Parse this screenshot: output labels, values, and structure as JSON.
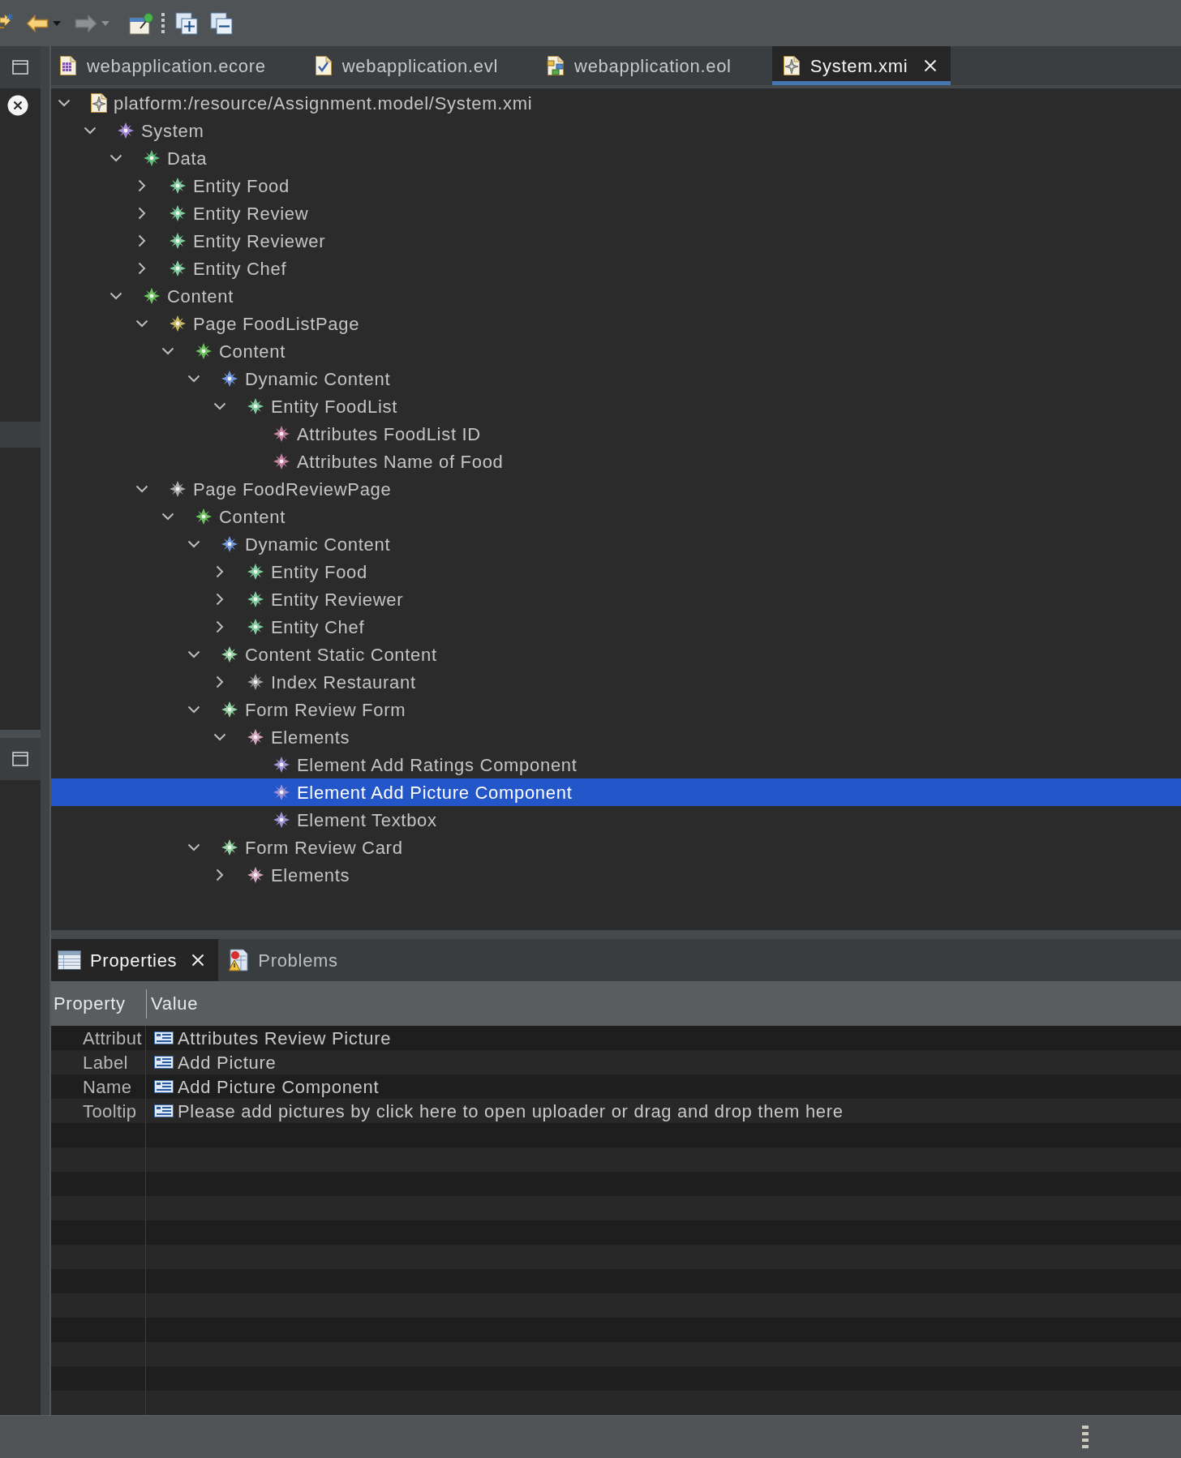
{
  "toolbar": [
    {
      "kind": "sync",
      "disabled": false
    },
    {
      "kind": "back",
      "disabled": false
    },
    {
      "kind": "menu",
      "disabled": false
    },
    {
      "kind": "forward",
      "disabled": true
    },
    {
      "kind": "menu",
      "disabled": true
    },
    {
      "kind": "pin",
      "disabled": false
    },
    {
      "kind": "expand",
      "disabled": false
    },
    {
      "kind": "collapse",
      "disabled": false
    }
  ],
  "editor_tabs": [
    {
      "label": "webapplication.ecore",
      "kind": "ecore",
      "selected": false
    },
    {
      "label": "webapplication.evl",
      "kind": "evl",
      "selected": false
    },
    {
      "label": "webapplication.eol",
      "kind": "eol",
      "selected": false
    },
    {
      "label": "System.xmi",
      "kind": "xmi",
      "selected": true
    }
  ],
  "tree": {
    "label": "platform:/resource/Assignment.model/System.xmi",
    "expanded": true,
    "selected": false,
    "children": [
      {
        "label": "System",
        "color": "#a98ad8",
        "expanded": true,
        "selected": false,
        "children": [
          {
            "label": "Data",
            "color": "#5fbf78",
            "expanded": true,
            "selected": false,
            "children": [
              {
                "label": "Entity Food",
                "color": "#7fcd9c",
                "expanded": false,
                "selected": false
              },
              {
                "label": "Entity Review",
                "color": "#7fcd9c",
                "expanded": false,
                "selected": false
              },
              {
                "label": "Entity Reviewer",
                "color": "#7fcd9c",
                "expanded": false,
                "selected": false
              },
              {
                "label": "Entity Chef",
                "color": "#7fcd9c",
                "expanded": false,
                "selected": false
              }
            ]
          },
          {
            "label": "Content",
            "color": "#6cc35e",
            "expanded": true,
            "selected": false,
            "children": [
              {
                "label": "Page FoodListPage",
                "color": "#c9b860",
                "expanded": true,
                "selected": false,
                "children": [
                  {
                    "label": "Content",
                    "color": "#6cc35e",
                    "expanded": true,
                    "selected": false,
                    "children": [
                      {
                        "label": "Dynamic Content",
                        "color": "#6f98dc",
                        "expanded": true,
                        "selected": false,
                        "children": [
                          {
                            "label": "Entity FoodList",
                            "color": "#7fcd9c",
                            "expanded": true,
                            "selected": false,
                            "children": [
                              {
                                "label": "Attributes FoodList ID",
                                "color": "#c47fa0",
                                "selected": false
                              },
                              {
                                "label": "Attributes Name of Food",
                                "color": "#c47fa0",
                                "selected": false
                              }
                            ]
                          }
                        ]
                      }
                    ]
                  }
                ]
              },
              {
                "label": "Page FoodReviewPage",
                "color": "#a9a9a9",
                "expanded": true,
                "selected": false,
                "children": [
                  {
                    "label": "Content",
                    "color": "#6cc35e",
                    "expanded": true,
                    "selected": false,
                    "children": [
                      {
                        "label": "Dynamic Content",
                        "color": "#6f98dc",
                        "expanded": true,
                        "selected": false,
                        "children": [
                          {
                            "label": "Entity Food",
                            "color": "#7fcd9c",
                            "expanded": false,
                            "selected": false
                          },
                          {
                            "label": "Entity Reviewer",
                            "color": "#7fcd9c",
                            "expanded": false,
                            "selected": false
                          },
                          {
                            "label": "Entity Chef",
                            "color": "#7fcd9c",
                            "expanded": false,
                            "selected": false
                          }
                        ]
                      },
                      {
                        "label": "Content Static Content",
                        "color": "#95d5a4",
                        "expanded": true,
                        "selected": false,
                        "children": [
                          {
                            "label": "Index Restaurant",
                            "color": "#9e9e9e",
                            "expanded": false,
                            "selected": false
                          }
                        ]
                      },
                      {
                        "label": "Form Review Form",
                        "color": "#95d5a4",
                        "expanded": true,
                        "selected": false,
                        "children": [
                          {
                            "label": "Elements",
                            "color": "#d4a6c0",
                            "expanded": true,
                            "selected": false,
                            "children": [
                              {
                                "label": "Element Add Ratings Component",
                                "color": "#9b91d4",
                                "selected": false
                              },
                              {
                                "label": "Element Add Picture Component",
                                "color": "#9b91d4",
                                "selected": true
                              },
                              {
                                "label": "Element Textbox",
                                "color": "#9b91d4",
                                "selected": false
                              }
                            ]
                          }
                        ]
                      },
                      {
                        "label": "Form Review Card",
                        "color": "#95d5a4",
                        "expanded": true,
                        "selected": false,
                        "children": [
                          {
                            "label": "Elements",
                            "color": "#d4a6c0",
                            "expanded": false,
                            "selected": false
                          }
                        ]
                      }
                    ]
                  }
                ]
              }
            ]
          }
        ]
      }
    ]
  },
  "panel_tabs": [
    {
      "label": "Properties",
      "kind": "properties",
      "selected": true
    },
    {
      "label": "Problems",
      "kind": "problems",
      "selected": false
    }
  ],
  "properties": {
    "columns": [
      "Property",
      "Value"
    ],
    "rows": [
      {
        "property": "Attribut",
        "value": "Attributes Review Picture"
      },
      {
        "property": "Label",
        "value": "Add Picture"
      },
      {
        "property": "Name",
        "value": "Add Picture Component"
      },
      {
        "property": "Tooltip",
        "value": "Please add pictures by click here to open uploader or drag and drop them here"
      }
    ]
  }
}
